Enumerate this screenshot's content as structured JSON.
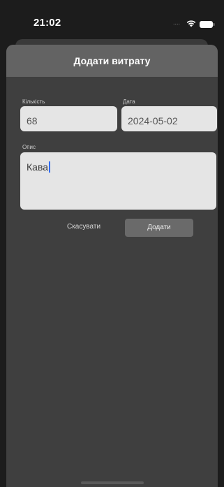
{
  "status_bar": {
    "time": "21:02",
    "signal_text": "....",
    "icons": [
      "wifi-icon",
      "battery-icon"
    ]
  },
  "sheet": {
    "title": "Додати витрату"
  },
  "form": {
    "amount": {
      "label": "Кількість",
      "value": "68"
    },
    "date": {
      "label": "Дата",
      "value": "2024-05-02"
    },
    "description": {
      "label": "Опис",
      "value": "Кава"
    }
  },
  "actions": {
    "cancel_label": "Скасувати",
    "add_label": "Додати"
  },
  "colors": {
    "background": "#1c1c1c",
    "sheet": "#3f3f3f",
    "header": "#636363",
    "field": "#e5e5e5",
    "caret": "#2f6cf4"
  }
}
